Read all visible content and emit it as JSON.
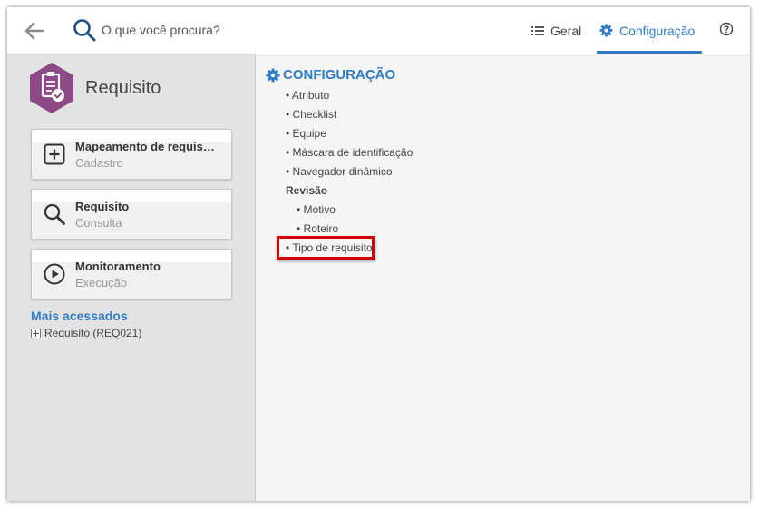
{
  "header": {
    "search_placeholder": "O que você procura?",
    "tabs": [
      {
        "label": "Geral",
        "active": false
      },
      {
        "label": "Configuração",
        "active": true
      }
    ],
    "accent_color": "#2f7cc5"
  },
  "sidebar": {
    "app_title": "Requisito",
    "app_color": "#8e4a86",
    "cards": [
      {
        "title": "Mapeamento de requis…",
        "subtitle": "Cadastro",
        "icon": "plus-square-icon"
      },
      {
        "title": "Requisito",
        "subtitle": "Consulta",
        "icon": "magnifier-icon"
      },
      {
        "title": "Monitoramento",
        "subtitle": "Execução",
        "icon": "play-circle-icon"
      }
    ],
    "most_accessed": {
      "title": "Mais acessados",
      "items": [
        {
          "label": "Requisito (REQ021)"
        }
      ]
    }
  },
  "config": {
    "title": "CONFIGURAÇÃO",
    "items": [
      "• Atributo",
      "• Checklist",
      "• Equipe",
      "• Máscara de identificação",
      "• Navegador dinâmico"
    ],
    "revisao": {
      "title": "Revisão",
      "items": [
        "• Motivo",
        "• Roteiro"
      ]
    },
    "highlighted_item": "• Tipo de requisito",
    "highlight_color": "#d40000"
  }
}
